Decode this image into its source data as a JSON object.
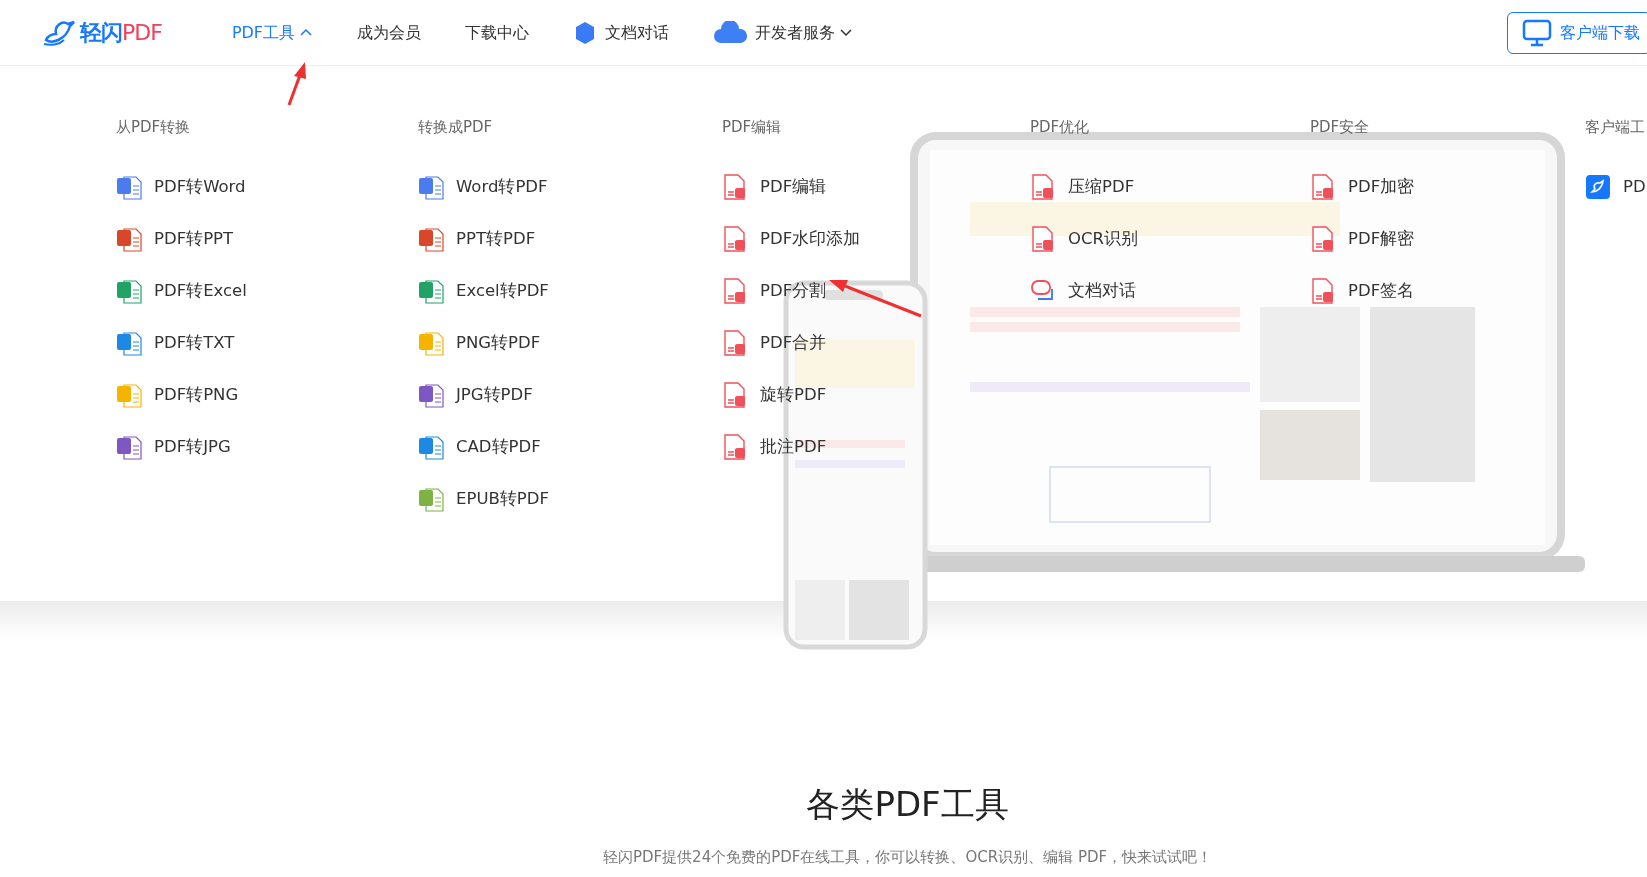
{
  "logo": {
    "brand": "轻闪",
    "suffix": "PDF"
  },
  "nav": [
    {
      "label": "PDF工具",
      "kind": "dropdown",
      "selected": true,
      "expanded": true
    },
    {
      "label": "成为会员",
      "kind": "link",
      "selected": false
    },
    {
      "label": "下载中心",
      "kind": "link",
      "selected": false
    },
    {
      "label": "文档对话",
      "kind": "ai",
      "selected": false
    },
    {
      "label": "开发者服务",
      "kind": "api",
      "selected": false,
      "expanded": false
    }
  ],
  "download_button": "客户端下载",
  "menu_columns": [
    {
      "title": "从PDF转换",
      "items": [
        {
          "label": "PDF转Word",
          "kind": "word"
        },
        {
          "label": "PDF转PPT",
          "kind": "ppt"
        },
        {
          "label": "PDF转Excel",
          "kind": "excel"
        },
        {
          "label": "PDF转TXT",
          "kind": "txt"
        },
        {
          "label": "PDF转PNG",
          "kind": "png"
        },
        {
          "label": "PDF转JPG",
          "kind": "jpg"
        }
      ]
    },
    {
      "title": "转换成PDF",
      "items": [
        {
          "label": "Word转PDF",
          "kind": "word"
        },
        {
          "label": "PPT转PDF",
          "kind": "ppt"
        },
        {
          "label": "Excel转PDF",
          "kind": "excel"
        },
        {
          "label": "PNG转PDF",
          "kind": "png"
        },
        {
          "label": "JPG转PDF",
          "kind": "jpg"
        },
        {
          "label": "CAD转PDF",
          "kind": "cad"
        },
        {
          "label": "EPUB转PDF",
          "kind": "epub"
        }
      ]
    },
    {
      "title": "PDF编辑",
      "items": [
        {
          "label": "PDF编辑",
          "kind": "pdf"
        },
        {
          "label": "PDF水印添加",
          "kind": "pdf"
        },
        {
          "label": "PDF分割",
          "kind": "pdf"
        },
        {
          "label": "PDF合并",
          "kind": "pdf"
        },
        {
          "label": "旋转PDF",
          "kind": "pdf"
        },
        {
          "label": "批注PDF",
          "kind": "pdf"
        }
      ]
    },
    {
      "title": "PDF优化",
      "items": [
        {
          "label": "压缩PDF",
          "kind": "pdf"
        },
        {
          "label": "OCR识别",
          "kind": "pdf"
        },
        {
          "label": "文档对话",
          "kind": "chat"
        }
      ]
    },
    {
      "title": "PDF安全",
      "items": [
        {
          "label": "PDF加密",
          "kind": "pdf"
        },
        {
          "label": "PDF解密",
          "kind": "pdf"
        },
        {
          "label": "PDF签名",
          "kind": "pdf"
        }
      ]
    },
    {
      "title": "客户端工",
      "items": [
        {
          "label": "PD",
          "kind": "app"
        }
      ]
    }
  ],
  "section": {
    "title": "各类PDF工具",
    "subtitle": "轻闪PDF提供24个免费的PDF在线工具，你可以转换、OCR识别、编辑 PDF，快来试试吧！"
  }
}
